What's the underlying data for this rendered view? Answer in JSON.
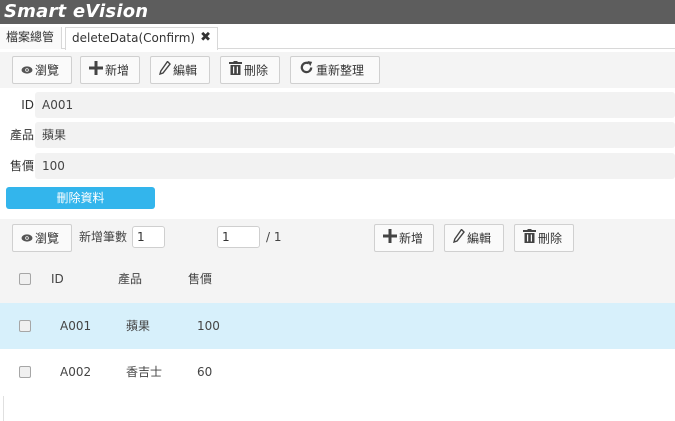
{
  "app": {
    "title": "Smart eVision"
  },
  "tabs": [
    {
      "label": "檔案總管"
    },
    {
      "label": "deleteData(Confirm)",
      "close": "✖"
    }
  ],
  "toolbar": {
    "browse": "瀏覽",
    "add": "新增",
    "edit": "編輯",
    "delete": "刪除",
    "refresh": "重新整理"
  },
  "form": {
    "fields": [
      {
        "label": "ID",
        "value": "A001"
      },
      {
        "label": "產品",
        "value": "蘋果"
      },
      {
        "label": "售價",
        "value": "100"
      }
    ],
    "delete_button": "刪除資料"
  },
  "grid_toolbar": {
    "browse": "瀏覽",
    "add_count_label": "新增筆數",
    "add_count_value": "1",
    "page_value": "1",
    "page_total": "/ 1",
    "add": "新增",
    "edit": "編輯",
    "delete": "刪除"
  },
  "grid": {
    "columns": [
      "ID",
      "產品",
      "售價"
    ],
    "rows": [
      {
        "id": "A001",
        "product": "蘋果",
        "price": "100"
      },
      {
        "id": "A002",
        "product": "香吉士",
        "price": "60"
      }
    ]
  }
}
